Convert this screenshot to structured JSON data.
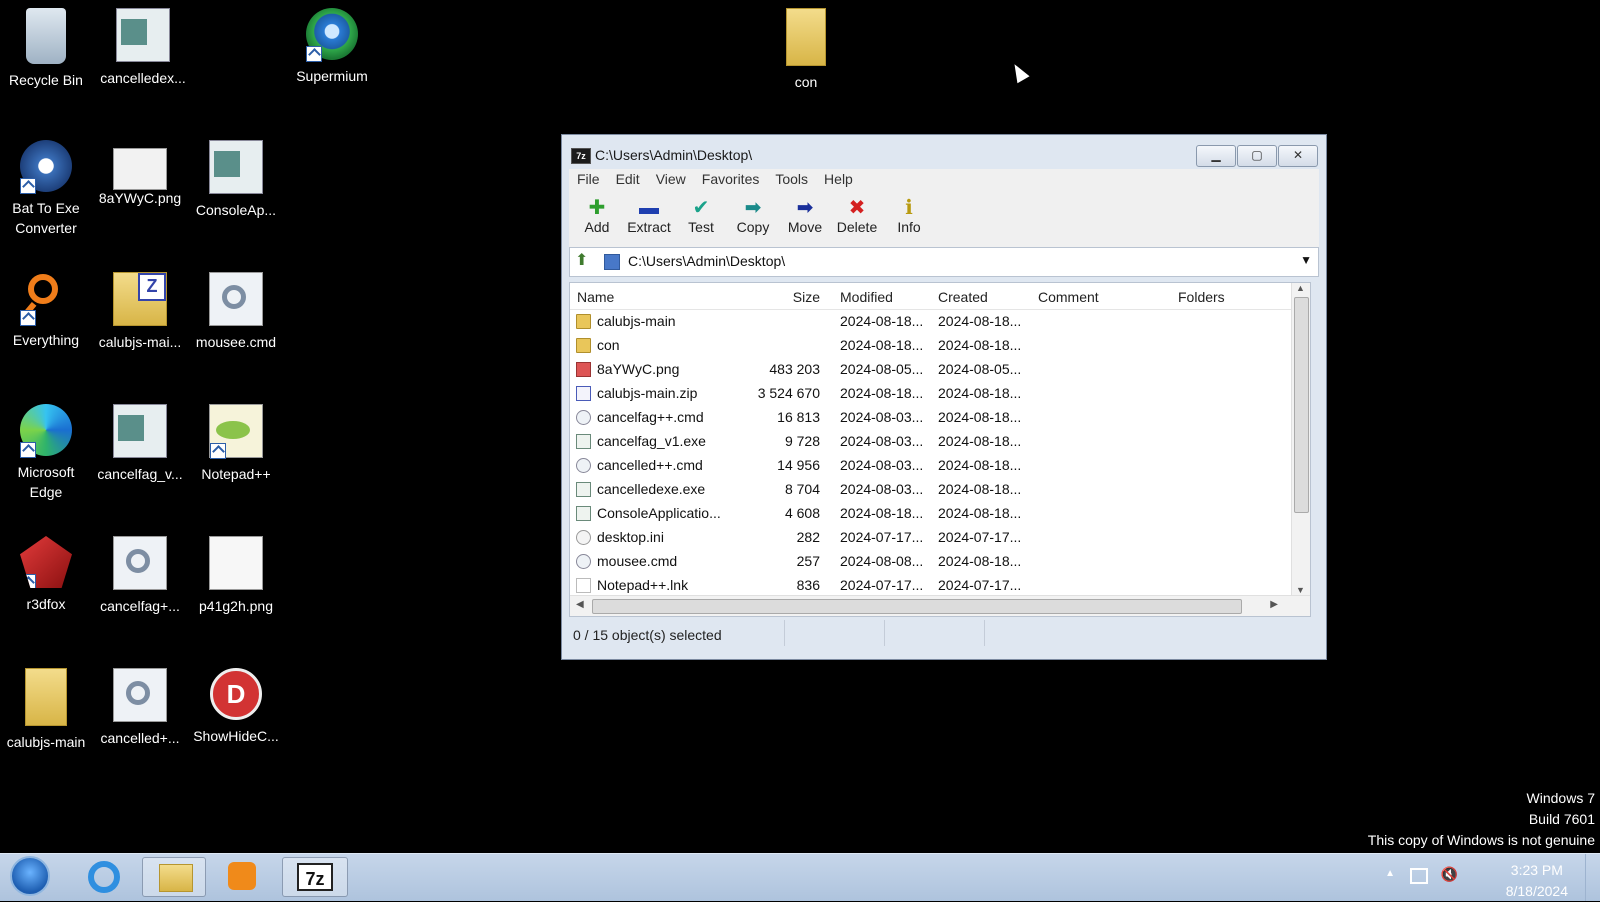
{
  "desktop": {
    "icons": [
      {
        "label": "Recycle Bin"
      },
      {
        "label": "cancelledex..."
      },
      {
        "label": "Supermium"
      },
      {
        "label": "con"
      },
      {
        "label": "Bat To Exe Converter"
      },
      {
        "label": "8aYWyC.png"
      },
      {
        "label": "ConsoleAp..."
      },
      {
        "label": "Everything"
      },
      {
        "label": "calubjs-mai..."
      },
      {
        "label": "mousee.cmd"
      },
      {
        "label": "Microsoft Edge"
      },
      {
        "label": "cancelfag_v..."
      },
      {
        "label": "Notepad++"
      },
      {
        "label": "r3dfox"
      },
      {
        "label": "cancelfag+..."
      },
      {
        "label": "p41g2h.png"
      },
      {
        "label": "calubjs-main"
      },
      {
        "label": "cancelled+..."
      },
      {
        "label": "ShowHideC..."
      }
    ]
  },
  "window": {
    "title": "C:\\Users\\Admin\\Desktop\\",
    "app_icon": "7z",
    "menu": [
      "File",
      "Edit",
      "View",
      "Favorites",
      "Tools",
      "Help"
    ],
    "toolbar": [
      {
        "label": "Add",
        "icon": "plus-icon",
        "glyph": "✚",
        "color": "#2e9e2e"
      },
      {
        "label": "Extract",
        "icon": "minus-icon",
        "glyph": "▬",
        "color": "#1f3fb0"
      },
      {
        "label": "Test",
        "icon": "checkmark-icon",
        "glyph": "✔",
        "color": "#1aa28a"
      },
      {
        "label": "Copy",
        "icon": "copy-arrow-icon",
        "glyph": "➡",
        "color": "#1a8a8a"
      },
      {
        "label": "Move",
        "icon": "move-arrow-icon",
        "glyph": "➡",
        "color": "#1a2f9a"
      },
      {
        "label": "Delete",
        "icon": "delete-x-icon",
        "glyph": "✖",
        "color": "#d42020"
      },
      {
        "label": "Info",
        "icon": "info-icon",
        "glyph": "ℹ",
        "color": "#b89a10"
      }
    ],
    "address": "C:\\Users\\Admin\\Desktop\\",
    "columns": [
      "Name",
      "Size",
      "Modified",
      "Created",
      "Comment",
      "Folders"
    ],
    "files": [
      {
        "name": "calubjs-main",
        "size": "",
        "modified": "2024-08-18...",
        "created": "2024-08-18...",
        "type": "folder"
      },
      {
        "name": "con",
        "size": "",
        "modified": "2024-08-18...",
        "created": "2024-08-18...",
        "type": "folder"
      },
      {
        "name": "8aYWyC.png",
        "size": "483 203",
        "modified": "2024-08-05...",
        "created": "2024-08-05...",
        "type": "png"
      },
      {
        "name": "calubjs-main.zip",
        "size": "3 524 670",
        "modified": "2024-08-18...",
        "created": "2024-08-18...",
        "type": "zip"
      },
      {
        "name": "cancelfag++.cmd",
        "size": "16 813",
        "modified": "2024-08-03...",
        "created": "2024-08-18...",
        "type": "cmd"
      },
      {
        "name": "cancelfag_v1.exe",
        "size": "9 728",
        "modified": "2024-08-03...",
        "created": "2024-08-18...",
        "type": "exe"
      },
      {
        "name": "cancelled++.cmd",
        "size": "14 956",
        "modified": "2024-08-03...",
        "created": "2024-08-18...",
        "type": "cmd"
      },
      {
        "name": "cancelledexe.exe",
        "size": "8 704",
        "modified": "2024-08-03...",
        "created": "2024-08-18...",
        "type": "exe"
      },
      {
        "name": "ConsoleApplicatio...",
        "size": "4 608",
        "modified": "2024-08-18...",
        "created": "2024-08-18...",
        "type": "exe"
      },
      {
        "name": "desktop.ini",
        "size": "282",
        "modified": "2024-07-17...",
        "created": "2024-07-17...",
        "type": "ini"
      },
      {
        "name": "mousee.cmd",
        "size": "257",
        "modified": "2024-08-08...",
        "created": "2024-08-18...",
        "type": "cmd"
      },
      {
        "name": "Notepad++.lnk",
        "size": "836",
        "modified": "2024-07-17...",
        "created": "2024-07-17...",
        "type": "lnk"
      }
    ],
    "status": "0 / 15 object(s) selected"
  },
  "watermark": {
    "line1": "Windows 7",
    "line2": "Build 7601",
    "line3": "This copy of Windows is not genuine"
  },
  "taskbar": {
    "time": "3:23 PM",
    "date": "8/18/2024",
    "active_app_label": "7z"
  }
}
